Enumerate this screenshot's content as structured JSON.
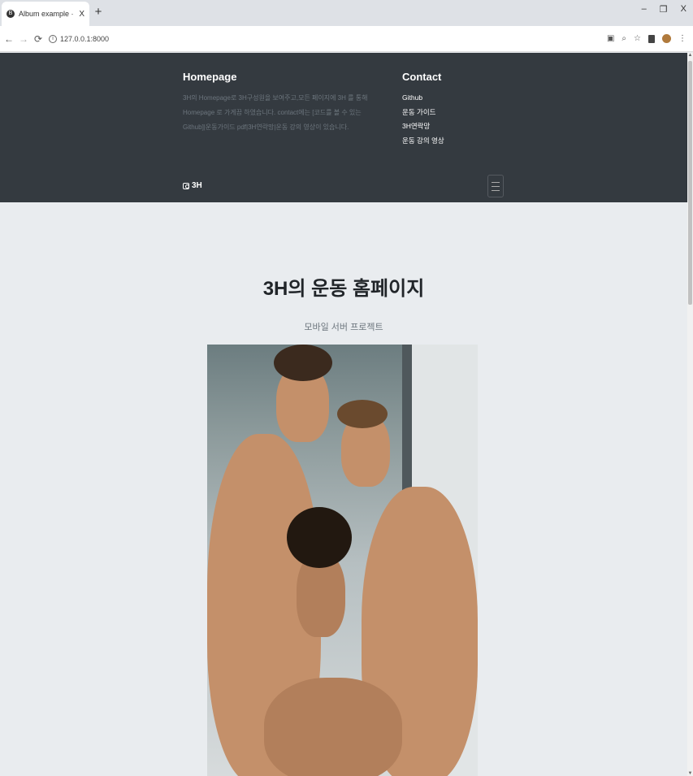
{
  "browser": {
    "tab_title": "Album example · Bootstrap",
    "tab_close": "X",
    "new_tab": "+",
    "url": "127.0.0.1:8000",
    "window_controls": {
      "minimize": "–",
      "restore": "❐",
      "close": "X"
    }
  },
  "header": {
    "homepage": {
      "title": "Homepage",
      "text": "3H의 Homepage로 3H구성원을 보여주고,모든 페이지에 3H 를 통해 Homepage 로 가게끔 하였습니다. contact에는 [코드를 볼 수 있는 Github]|운동가이드 pdf|3H연락망|운동 강의 영상이 있습니다."
    },
    "contact": {
      "title": "Contact",
      "links": [
        "Github",
        "운동 가이드",
        "3H연락망",
        "운동 강의 영상"
      ]
    }
  },
  "navbar": {
    "brand": "3H"
  },
  "hero": {
    "title": "3H의 운동 홈페이지",
    "subtitle": "모바일 서버 프로젝트"
  }
}
